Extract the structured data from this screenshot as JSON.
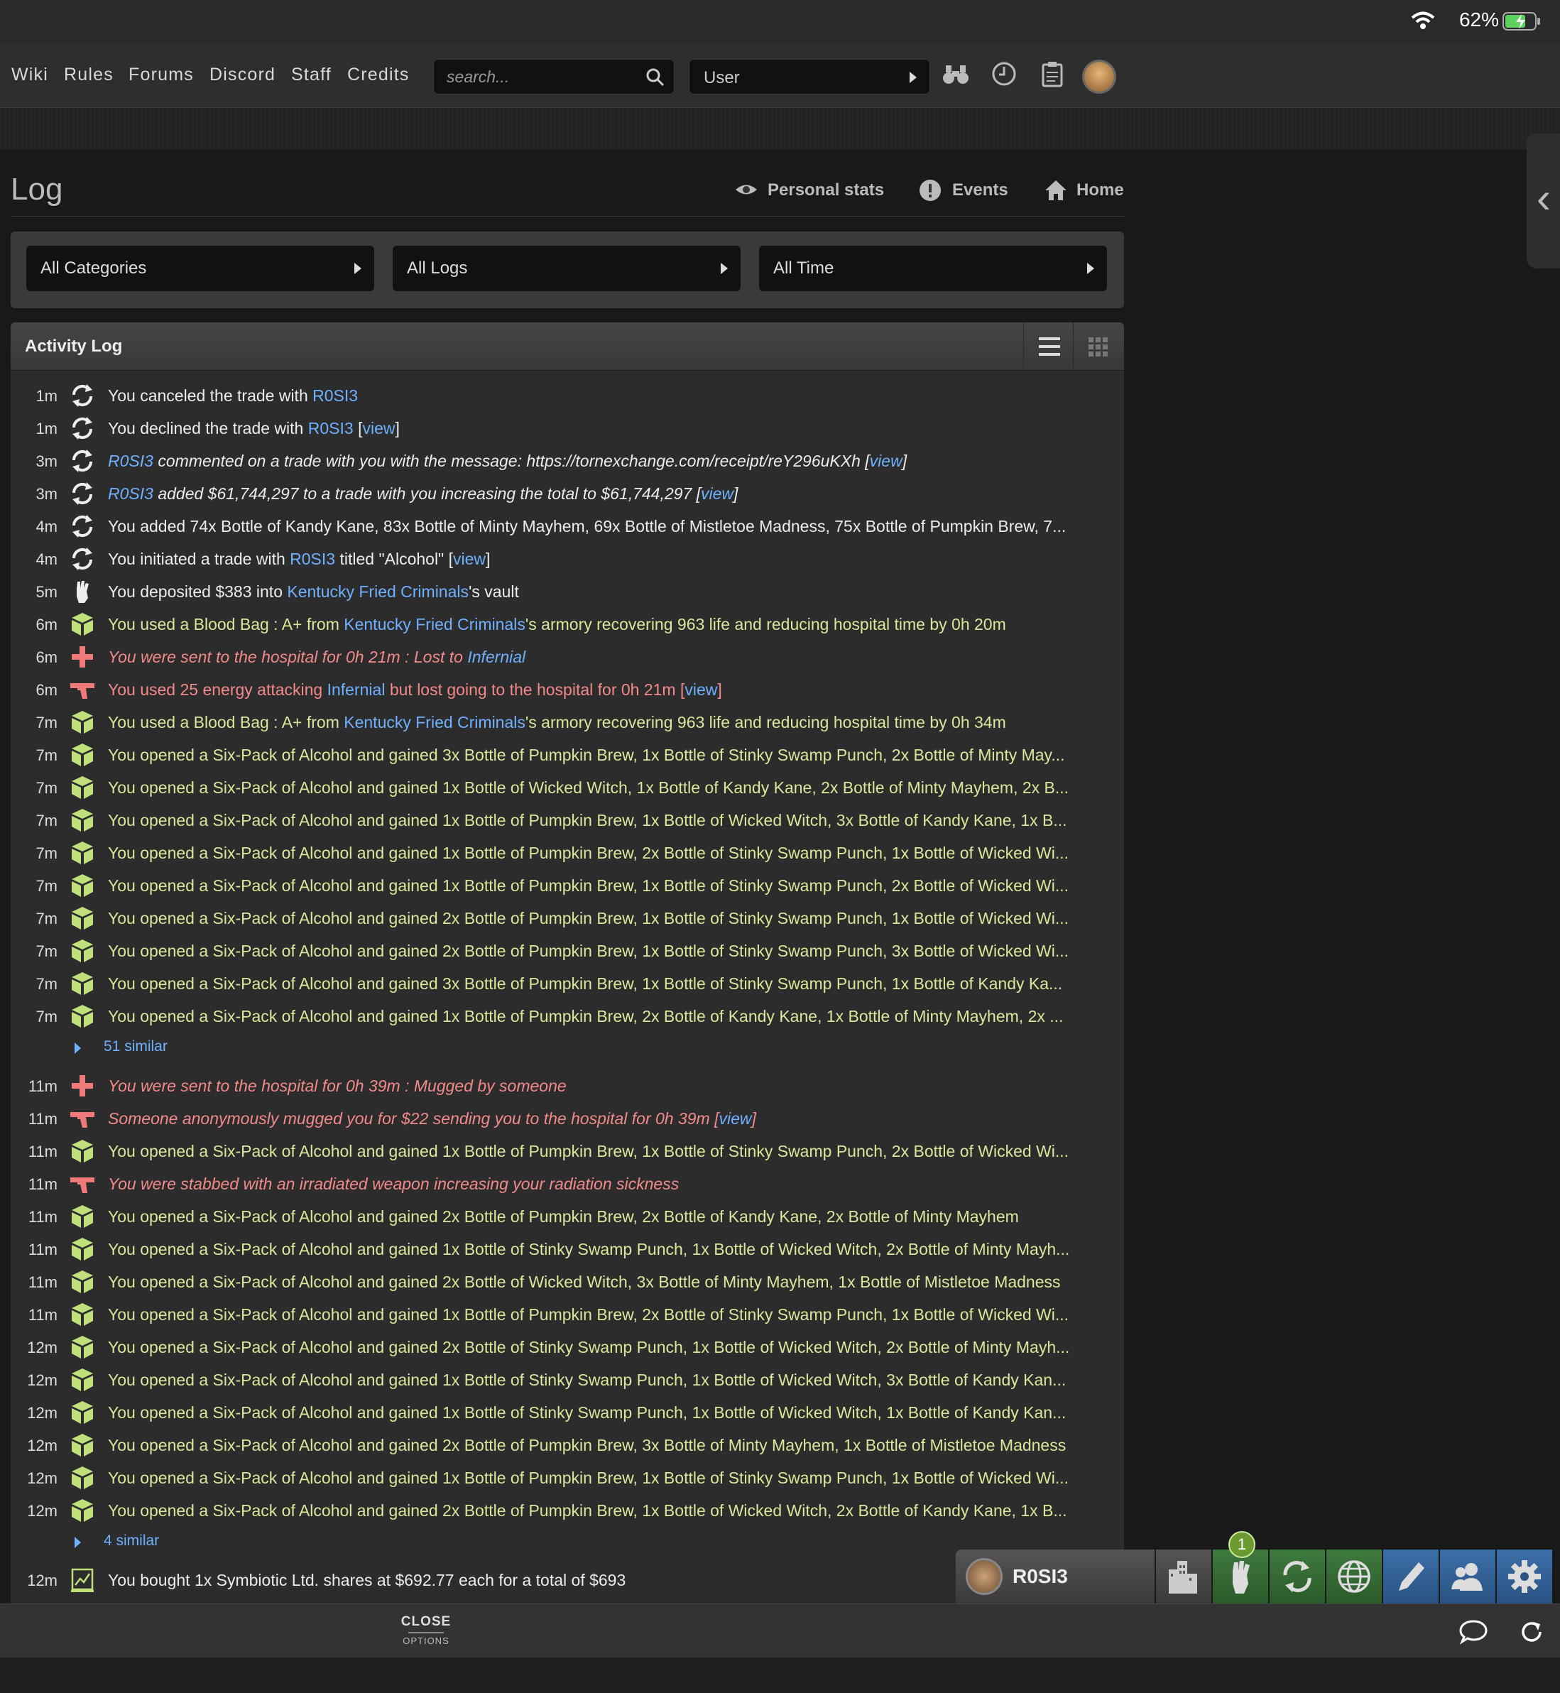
{
  "status": {
    "battery": "62%"
  },
  "nav": {
    "links": [
      "Wiki",
      "Rules",
      "Forums",
      "Discord",
      "Staff",
      "Credits"
    ],
    "search_placeholder": "search...",
    "user_select": "User"
  },
  "page": {
    "title": "Log",
    "links": [
      "Personal stats",
      "Events",
      "Home"
    ]
  },
  "filters": [
    "All Categories",
    "All Logs",
    "All Time"
  ],
  "activity": {
    "title": "Activity Log"
  },
  "rows": [
    {
      "time": "1m",
      "icon": "trade-icon",
      "style": "white",
      "parts": [
        [
          "You canceled the trade with ",
          ""
        ],
        [
          "R0SI3",
          "lnk"
        ]
      ]
    },
    {
      "time": "1m",
      "icon": "trade-icon",
      "style": "white",
      "parts": [
        [
          "You declined the trade with ",
          ""
        ],
        [
          "R0SI3",
          "lnk"
        ],
        [
          " [",
          ""
        ],
        [
          "view",
          "lnk"
        ],
        [
          "]",
          ""
        ]
      ]
    },
    {
      "time": "3m",
      "icon": "trade-icon",
      "style": "white italic",
      "parts": [
        [
          "R0SI3",
          "lnk"
        ],
        [
          " commented on a trade with you with the message: https://tornexchange.com/receipt/reY296uKXh [",
          ""
        ],
        [
          "view",
          "lnk"
        ],
        [
          "]",
          ""
        ]
      ]
    },
    {
      "time": "3m",
      "icon": "trade-icon",
      "style": "white italic",
      "parts": [
        [
          "R0SI3",
          "lnk"
        ],
        [
          " added $61,744,297 to a trade with you increasing the total to $61,744,297 [",
          ""
        ],
        [
          "view",
          "lnk"
        ],
        [
          "]",
          ""
        ]
      ]
    },
    {
      "time": "4m",
      "icon": "trade-icon",
      "style": "white",
      "parts": [
        [
          "You added 74x Bottle of Kandy Kane, 83x Bottle of Minty Mayhem, 69x Bottle of Mistletoe Madness, 75x Bottle of Pumpkin Brew, 7...",
          ""
        ]
      ]
    },
    {
      "time": "4m",
      "icon": "trade-icon",
      "style": "white",
      "parts": [
        [
          "You initiated a trade with ",
          ""
        ],
        [
          "R0SI3",
          "lnk"
        ],
        [
          " titled \"Alcohol\" [",
          ""
        ],
        [
          "view",
          "lnk"
        ],
        [
          "]",
          ""
        ]
      ]
    },
    {
      "time": "5m",
      "icon": "faction-icon",
      "style": "white",
      "parts": [
        [
          "You deposited $383 into ",
          ""
        ],
        [
          "Kentucky Fried Criminals",
          "lnk"
        ],
        [
          "'s vault",
          ""
        ]
      ]
    },
    {
      "time": "6m",
      "icon": "item-icon",
      "style": "green",
      "parts": [
        [
          "You used a Blood Bag : A+ from ",
          ""
        ],
        [
          "Kentucky Fried Criminals",
          "lnk"
        ],
        [
          "'s armory recovering 963 life and reducing hospital time by 0h 20m",
          ""
        ]
      ]
    },
    {
      "time": "6m",
      "icon": "hospital-icon",
      "style": "red italic",
      "parts": [
        [
          "You were sent to the hospital for 0h 21m : Lost to ",
          ""
        ],
        [
          "Infernial",
          "lnk"
        ]
      ]
    },
    {
      "time": "6m",
      "icon": "gun-icon",
      "style": "red",
      "parts": [
        [
          "You used 25 energy attacking ",
          ""
        ],
        [
          "Infernial",
          "lnk"
        ],
        [
          " but lost going to the hospital for 0h 21m [",
          ""
        ],
        [
          "view",
          "lnk"
        ],
        [
          "]",
          ""
        ]
      ]
    },
    {
      "time": "7m",
      "icon": "item-icon",
      "style": "green",
      "parts": [
        [
          "You used a Blood Bag : A+ from ",
          ""
        ],
        [
          "Kentucky Fried Criminals",
          "lnk"
        ],
        [
          "'s armory recovering 963 life and reducing hospital time by 0h 34m",
          ""
        ]
      ]
    },
    {
      "time": "7m",
      "icon": "item-icon",
      "style": "green",
      "parts": [
        [
          "You opened a Six-Pack of Alcohol and gained 3x Bottle of Pumpkin Brew, 1x Bottle of Stinky Swamp Punch, 2x Bottle of Minty May...",
          ""
        ]
      ]
    },
    {
      "time": "7m",
      "icon": "item-icon",
      "style": "green",
      "parts": [
        [
          "You opened a Six-Pack of Alcohol and gained 1x Bottle of Wicked Witch, 1x Bottle of Kandy Kane, 2x Bottle of Minty Mayhem, 2x B...",
          ""
        ]
      ]
    },
    {
      "time": "7m",
      "icon": "item-icon",
      "style": "green",
      "parts": [
        [
          "You opened a Six-Pack of Alcohol and gained 1x Bottle of Pumpkin Brew, 1x Bottle of Wicked Witch, 3x Bottle of Kandy Kane, 1x B...",
          ""
        ]
      ]
    },
    {
      "time": "7m",
      "icon": "item-icon",
      "style": "green",
      "parts": [
        [
          "You opened a Six-Pack of Alcohol and gained 1x Bottle of Pumpkin Brew, 2x Bottle of Stinky Swamp Punch, 1x Bottle of Wicked Wi...",
          ""
        ]
      ]
    },
    {
      "time": "7m",
      "icon": "item-icon",
      "style": "green",
      "parts": [
        [
          "You opened a Six-Pack of Alcohol and gained 1x Bottle of Pumpkin Brew, 1x Bottle of Stinky Swamp Punch, 2x Bottle of Wicked Wi...",
          ""
        ]
      ]
    },
    {
      "time": "7m",
      "icon": "item-icon",
      "style": "green",
      "parts": [
        [
          "You opened a Six-Pack of Alcohol and gained 2x Bottle of Pumpkin Brew, 1x Bottle of Stinky Swamp Punch, 1x Bottle of Wicked Wi...",
          ""
        ]
      ]
    },
    {
      "time": "7m",
      "icon": "item-icon",
      "style": "green",
      "parts": [
        [
          "You opened a Six-Pack of Alcohol and gained 2x Bottle of Pumpkin Brew, 1x Bottle of Stinky Swamp Punch, 3x Bottle of Wicked Wi...",
          ""
        ]
      ]
    },
    {
      "time": "7m",
      "icon": "item-icon",
      "style": "green",
      "parts": [
        [
          "You opened a Six-Pack of Alcohol and gained 3x Bottle of Pumpkin Brew, 1x Bottle of Stinky Swamp Punch, 1x Bottle of Kandy Ka...",
          ""
        ]
      ]
    },
    {
      "time": "7m",
      "icon": "item-icon",
      "style": "green",
      "parts": [
        [
          "You opened a Six-Pack of Alcohol and gained 1x Bottle of Pumpkin Brew, 2x Bottle of Kandy Kane, 1x Bottle of Minty Mayhem, 2x ...",
          ""
        ]
      ]
    },
    {
      "similar": "51 similar"
    },
    {
      "time": "11m",
      "icon": "hospital-icon",
      "style": "red italic",
      "parts": [
        [
          "You were sent to the hospital for 0h 39m : Mugged by someone",
          ""
        ]
      ]
    },
    {
      "time": "11m",
      "icon": "gun-icon",
      "style": "red italic",
      "parts": [
        [
          "Someone anonymously mugged you for $22 sending you to the hospital for 0h 39m [",
          ""
        ],
        [
          "view",
          "lnk"
        ],
        [
          "]",
          ""
        ]
      ]
    },
    {
      "time": "11m",
      "icon": "item-icon",
      "style": "green",
      "parts": [
        [
          "You opened a Six-Pack of Alcohol and gained 1x Bottle of Pumpkin Brew, 1x Bottle of Stinky Swamp Punch, 2x Bottle of Wicked Wi...",
          ""
        ]
      ]
    },
    {
      "time": "11m",
      "icon": "gun-icon",
      "style": "red italic",
      "parts": [
        [
          "You were stabbed with an irradiated weapon increasing your radiation sickness",
          ""
        ]
      ]
    },
    {
      "time": "11m",
      "icon": "item-icon",
      "style": "green",
      "parts": [
        [
          "You opened a Six-Pack of Alcohol and gained 2x Bottle of Pumpkin Brew, 2x Bottle of Kandy Kane, 2x Bottle of Minty Mayhem",
          ""
        ]
      ]
    },
    {
      "time": "11m",
      "icon": "item-icon",
      "style": "green",
      "parts": [
        [
          "You opened a Six-Pack of Alcohol and gained 1x Bottle of Stinky Swamp Punch, 1x Bottle of Wicked Witch, 2x Bottle of Minty Mayh...",
          ""
        ]
      ]
    },
    {
      "time": "11m",
      "icon": "item-icon",
      "style": "green",
      "parts": [
        [
          "You opened a Six-Pack of Alcohol and gained 2x Bottle of Wicked Witch, 3x Bottle of Minty Mayhem, 1x Bottle of Mistletoe Madness",
          ""
        ]
      ]
    },
    {
      "time": "11m",
      "icon": "item-icon",
      "style": "green",
      "parts": [
        [
          "You opened a Six-Pack of Alcohol and gained 1x Bottle of Pumpkin Brew, 2x Bottle of Stinky Swamp Punch, 1x Bottle of Wicked Wi...",
          ""
        ]
      ]
    },
    {
      "time": "12m",
      "icon": "item-icon",
      "style": "green",
      "parts": [
        [
          "You opened a Six-Pack of Alcohol and gained 2x Bottle of Stinky Swamp Punch, 1x Bottle of Wicked Witch, 2x Bottle of Minty Mayh...",
          ""
        ]
      ]
    },
    {
      "time": "12m",
      "icon": "item-icon",
      "style": "green",
      "parts": [
        [
          "You opened a Six-Pack of Alcohol and gained 1x Bottle of Stinky Swamp Punch, 1x Bottle of Wicked Witch, 3x Bottle of Kandy Kan...",
          ""
        ]
      ]
    },
    {
      "time": "12m",
      "icon": "item-icon",
      "style": "green",
      "parts": [
        [
          "You opened a Six-Pack of Alcohol and gained 1x Bottle of Stinky Swamp Punch, 1x Bottle of Wicked Witch, 1x Bottle of Kandy Kan...",
          ""
        ]
      ]
    },
    {
      "time": "12m",
      "icon": "item-icon",
      "style": "green",
      "parts": [
        [
          "You opened a Six-Pack of Alcohol and gained 2x Bottle of Pumpkin Brew, 3x Bottle of Minty Mayhem, 1x Bottle of Mistletoe Madness",
          ""
        ]
      ]
    },
    {
      "time": "12m",
      "icon": "item-icon",
      "style": "green",
      "parts": [
        [
          "You opened a Six-Pack of Alcohol and gained 1x Bottle of Pumpkin Brew, 1x Bottle of Stinky Swamp Punch, 1x Bottle of Wicked Wi...",
          ""
        ]
      ]
    },
    {
      "time": "12m",
      "icon": "item-icon",
      "style": "green",
      "parts": [
        [
          "You opened a Six-Pack of Alcohol and gained 2x Bottle of Pumpkin Brew, 1x Bottle of Wicked Witch, 2x Bottle of Kandy Kane, 1x B...",
          ""
        ]
      ]
    },
    {
      "similar": "4 similar"
    },
    {
      "time": "12m",
      "icon": "stocks-icon",
      "style": "white",
      "parts": [
        [
          "You bought 1x Symbiotic Ltd. shares at $692.77 each for a total of $693",
          ""
        ]
      ]
    }
  ],
  "bottom": {
    "close": "CLOSE",
    "options": "OPTIONS"
  },
  "dock": {
    "user": "R0SI3",
    "badge": "1"
  }
}
